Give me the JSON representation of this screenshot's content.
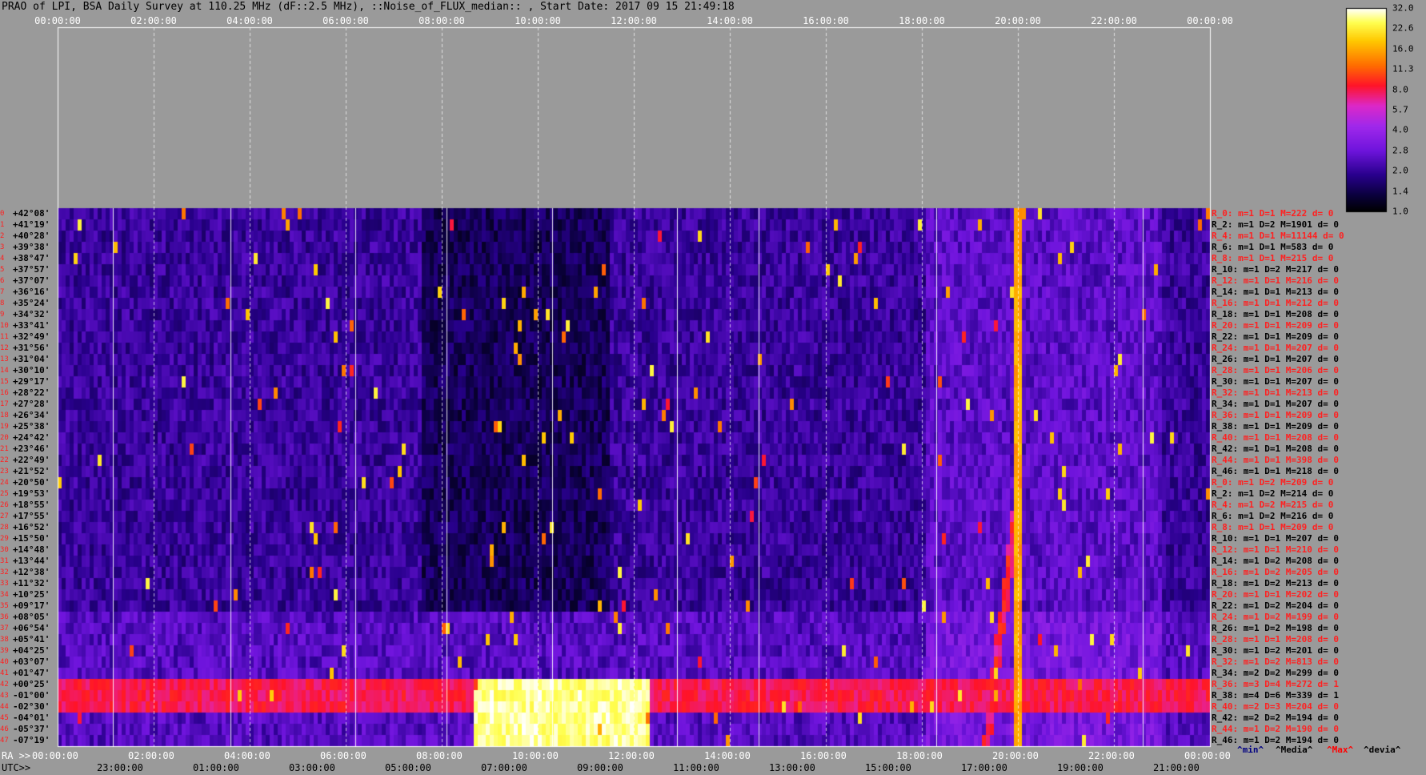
{
  "title": "PRAO of LPI, BSA Daily Survey at 110.25 MHz (dF::2.5 MHz), ::Noise_of_FLUX_median:: , Start Date: 2017 09 15 21:49:18",
  "top_axis_ticks": [
    "00:00:00",
    "02:00:00",
    "04:00:00",
    "06:00:00",
    "08:00:00",
    "10:00:00",
    "12:00:00",
    "14:00:00",
    "16:00:00",
    "18:00:00",
    "20:00:00",
    "22:00:00",
    "00:00:00"
  ],
  "ra_axis": {
    "label": "RA >>",
    "ticks": [
      "00:00:00",
      "02:00:00",
      "04:00:00",
      "06:00:00",
      "08:00:00",
      "10:00:00",
      "12:00:00",
      "14:00:00",
      "16:00:00",
      "18:00:00",
      "20:00:00",
      "22:00:00",
      "00:00:00"
    ]
  },
  "utc_axis": {
    "label": "UTC>>",
    "ticks": [
      "23:00:00",
      "01:00:00",
      "03:00:00",
      "05:00:00",
      "07:00:00",
      "09:00:00",
      "11:00:00",
      "13:00:00",
      "15:00:00",
      "17:00:00",
      "19:00:00",
      "21:00:00"
    ]
  },
  "colorbar": {
    "labels": [
      "32.0",
      "22.6",
      "16.0",
      "11.3",
      "8.0",
      "5.7",
      "4.0",
      "2.8",
      "2.0",
      "1.4",
      "1.0"
    ]
  },
  "bottom_legend": {
    "min": "^min^",
    "media": "^Media^",
    "max": "^Max^",
    "devia": "^devia^"
  },
  "colors": {
    "background": "#9a9a9a",
    "label_red": "#ff2020",
    "label_black": "#000000",
    "legend_blue": "#000080",
    "legend_red": "#ff0000"
  },
  "chart_data": {
    "type": "heatmap",
    "x_axis": "RA / UTC time",
    "color_scale": "log",
    "color_range": [
      1.0,
      32.0
    ],
    "n_rows": 48,
    "declinations": [
      "+42°08'",
      "+41°19'",
      "+40°28'",
      "+39°38'",
      "+38°47'",
      "+37°57'",
      "+37°07'",
      "+36°16'",
      "+35°24'",
      "+34°32'",
      "+33°41'",
      "+32°49'",
      "+31°56'",
      "+31°04'",
      "+30°10'",
      "+29°17'",
      "+28°22'",
      "+27°28'",
      "+26°34'",
      "+25°38'",
      "+24°42'",
      "+23°46'",
      "+22°49'",
      "+21°52'",
      "+20°50'",
      "+19°53'",
      "+18°55'",
      "+17°55'",
      "+16°52'",
      "+15°50'",
      "+14°48'",
      "+13°44'",
      "+12°38'",
      "+11°32'",
      "+10°25'",
      "+09°17'",
      "+08°05'",
      "+06°54'",
      "+05°41'",
      "+04°25'",
      "+03°07'",
      "+01°47'",
      "+00°25'",
      "-01°00'",
      "-02°30'",
      "-04°01'",
      "-05°37'",
      "-07°19'"
    ],
    "row_stats": [
      "R_0: m=1 D=1 M=222 d= 0",
      "R_2: m=1 D=2 M=1901 d= 0",
      "R_4: m=1 D=1 M=11144 d= 0",
      "R_6: m=1 D=1 M=583 d= 0",
      "R_8: m=1 D=1 M=215 d= 0",
      "R_10: m=1 D=2 M=217 d= 0",
      "R_12: m=1 D=1 M=216 d= 0",
      "R_14: m=1 D=1 M=213 d= 0",
      "R_16: m=1 D=1 M=212 d= 0",
      "R_18: m=1 D=1 M=208 d= 0",
      "R_20: m=1 D=1 M=209 d= 0",
      "R_22: m=1 D=1 M=209 d= 0",
      "R_24: m=1 D=1 M=207 d= 0",
      "R_26: m=1 D=1 M=207 d= 0",
      "R_28: m=1 D=1 M=206 d= 0",
      "R_30: m=1 D=1 M=207 d= 0",
      "R_32: m=1 D=1 M=213 d= 0",
      "R_34: m=1 D=1 M=207 d= 0",
      "R_36: m=1 D=1 M=209 d= 0",
      "R_38: m=1 D=1 M=209 d= 0",
      "R_40: m=1 D=1 M=208 d= 0",
      "R_42: m=1 D=1 M=208 d= 0",
      "R_44: m=1 D=1 M=398 d= 0",
      "R_46: m=1 D=1 M=218 d= 0",
      "R_0: m=1 D=2 M=209 d= 0",
      "R_2: m=1 D=2 M=214 d= 0",
      "R_4: m=1 D=2 M=215 d= 0",
      "R_6: m=1 D=2 M=216 d= 0",
      "R_8: m=1 D=1 M=209 d= 0",
      "R_10: m=1 D=1 M=207 d= 0",
      "R_12: m=1 D=1 M=210 d= 0",
      "R_14: m=1 D=2 M=208 d= 0",
      "R_16: m=1 D=2 M=205 d= 0",
      "R_18: m=1 D=2 M=213 d= 0",
      "R_20: m=1 D=1 M=202 d= 0",
      "R_22: m=1 D=2 M=204 d= 0",
      "R_24: m=1 D=2 M=199 d= 0",
      "R_26: m=1 D=2 M=198 d= 0",
      "R_28: m=1 D=1 M=208 d= 0",
      "R_30: m=1 D=2 M=201 d= 0",
      "R_32: m=1 D=2 M=813 d= 0",
      "R_34: m=2 D=2 M=299 d= 0",
      "R_36: m=3 D=4 M=272 d= 1",
      "R_38: m=4 D=6 M=339 d= 1",
      "R_40: m=2 D=3 M=204 d= 0",
      "R_42: m=2 D=2 M=194 d= 0",
      "R_44: m=1 D=2 M=190 d= 0",
      "R_46: m=1 D=2 M=194 d= 0"
    ],
    "features": [
      {
        "name": "vertical bright track near 20:00 RA",
        "ra_hours": [
          19.9,
          20.0
        ],
        "rows": [
          0,
          47
        ],
        "level": 16
      },
      {
        "name": "bright broadband patch",
        "ra_hours": [
          8.6,
          12.3
        ],
        "rows": [
          42,
          47
        ],
        "level": 28
      },
      {
        "name": "bright horizontal band",
        "ra_hours": [
          0,
          24
        ],
        "rows": [
          42,
          44
        ],
        "level": 8
      }
    ]
  }
}
